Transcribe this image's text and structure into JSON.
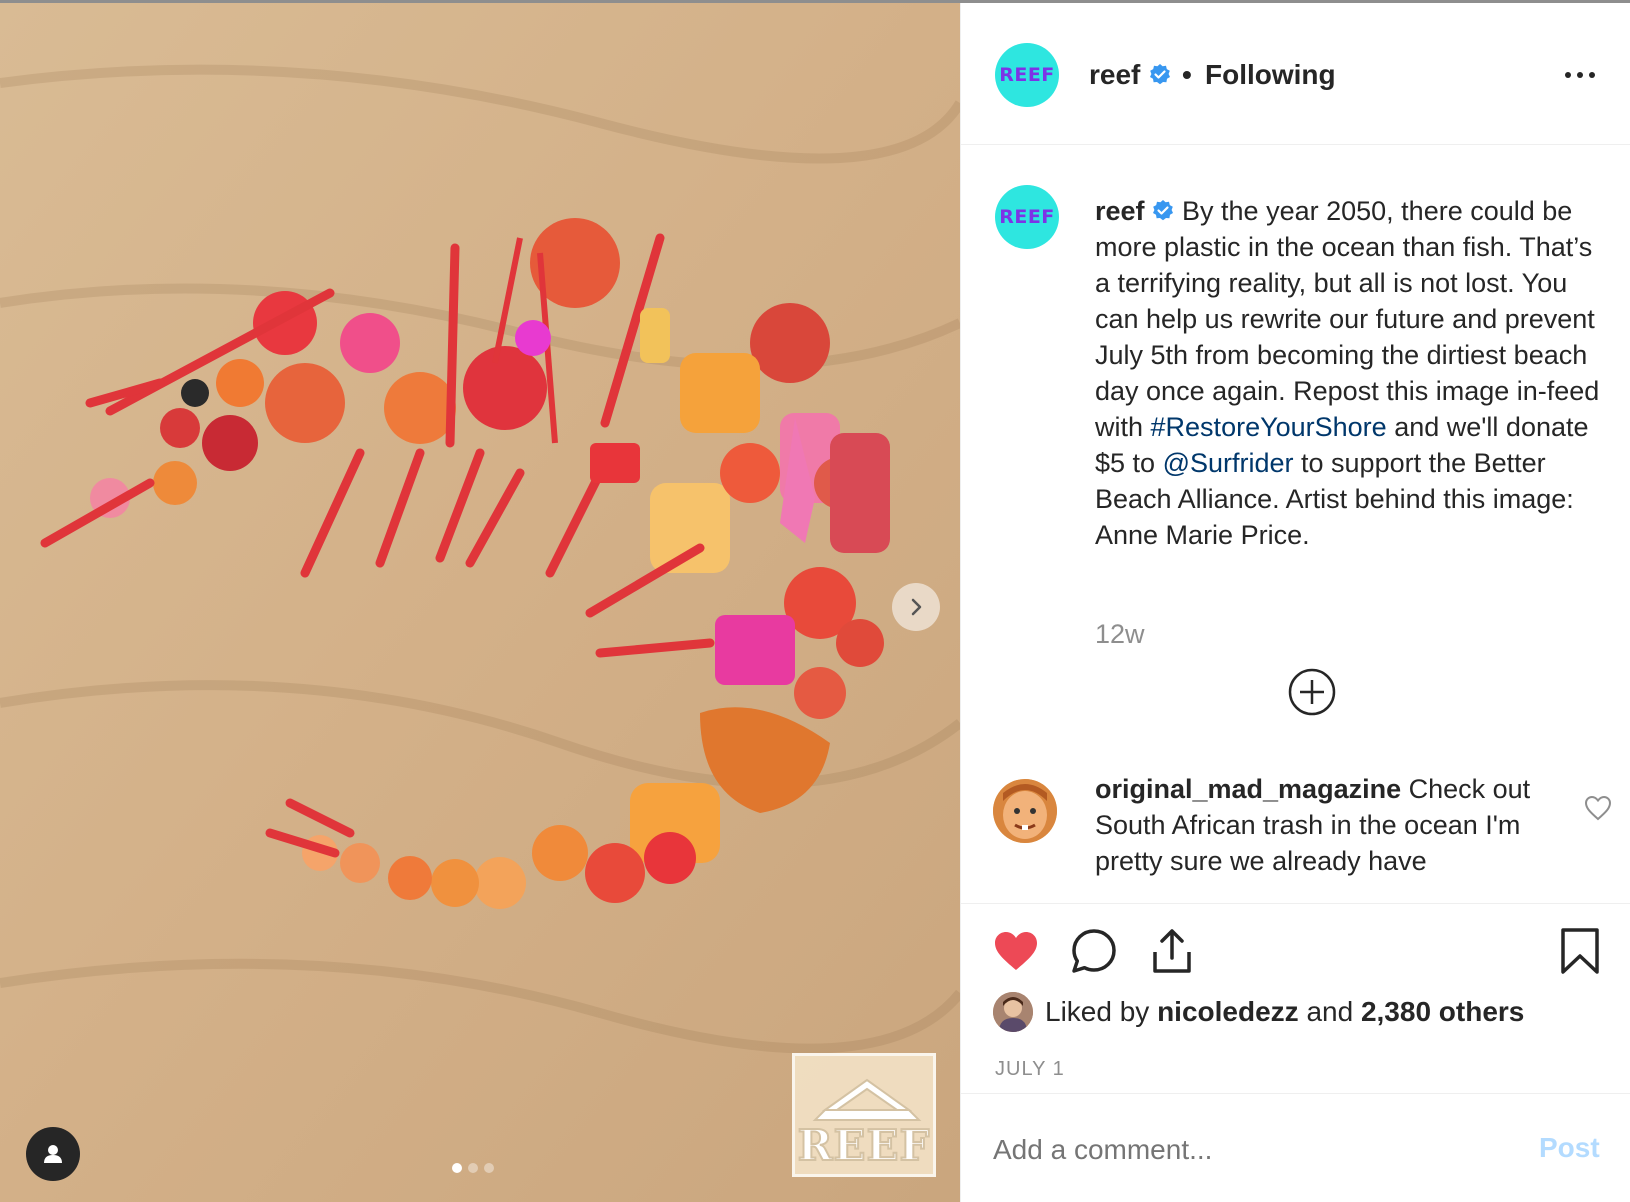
{
  "colors": {
    "accent_link": "#00376b",
    "verified_blue": "#3897f0",
    "like_red": "#ed4956",
    "reef_avatar_bg": "#2ee6e0",
    "reef_avatar_text": "#7d33e6",
    "post_disabled": "#b3dbff",
    "secondary_text": "#8e8e8e"
  },
  "post": {
    "avatar_text": "REEF",
    "username": "reef",
    "separator": "•",
    "follow_status": "Following",
    "more_icon": "more-horizontal-icon",
    "carousel": {
      "count": 3,
      "active_index": 0
    },
    "watermark_text": "REEF"
  },
  "caption": {
    "avatar_text": "REEF",
    "username": "reef",
    "text_1": " By the year 2050, there could be more plastic in the ocean than fish. That’s a terrifying reality, but all is not lost. You can help us rewrite our future and prevent July 5th from becoming the dirtiest beach day once again. Repost this image in-feed with ",
    "hashtag": "#RestoreYourShore",
    "text_2": " and we'll donate $5 to ",
    "mention": "@Surfrider",
    "text_3": " to support the Better Beach Alliance. Artist behind this image: Anne Marie Price.",
    "time": "12w"
  },
  "comment": {
    "username": "original_mad_magazine",
    "text": " Check out South African trash in the ocean I'm pretty sure we already have"
  },
  "actions": {
    "liked_prefix": "Liked by ",
    "liked_user": "nicoledezz",
    "liked_mid": " and ",
    "liked_count": "2,380 others",
    "date": "JULY 1"
  },
  "add_comment": {
    "placeholder": "Add a comment...",
    "post_label": "Post"
  }
}
